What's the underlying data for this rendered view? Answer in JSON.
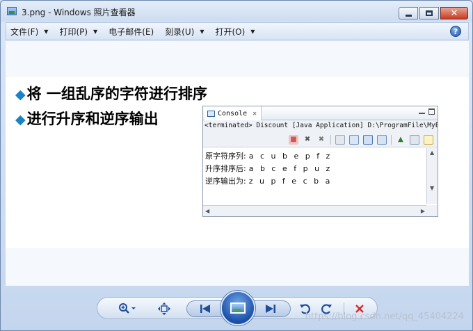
{
  "window": {
    "title": "3.png - Windows 照片查看器"
  },
  "menu": {
    "items": [
      {
        "label": "文件(F)",
        "has_arrow": true
      },
      {
        "label": "打印(P)",
        "has_arrow": true
      },
      {
        "label": "电子邮件(E)",
        "has_arrow": false
      },
      {
        "label": "刻录(U)",
        "has_arrow": true
      },
      {
        "label": "打开(O)",
        "has_arrow": true
      }
    ],
    "help_glyph": "?"
  },
  "slide": {
    "line1": "将 一组乱序的字符进行排序",
    "line2": "进行升序和逆序输出",
    "bullet_color": "#1a83c7"
  },
  "console": {
    "tab_label": "Console",
    "tab_close": "✕",
    "status": "<terminated> Discount [Java Application] D:\\ProgramFile\\MyE",
    "output": [
      {
        "label": "原字符序列:",
        "value": "a c u b e p f z"
      },
      {
        "label": "升序排序后:",
        "value": "a b c e f p u z"
      },
      {
        "label": "逆序输出为:",
        "value": "z u p f e c b a"
      }
    ]
  },
  "watermark": "https://blog.csdn.net/qq_45404224",
  "colors": {
    "accent": "#1d4d9b",
    "close_button": "#c63b22",
    "delete": "#d42b2b"
  }
}
